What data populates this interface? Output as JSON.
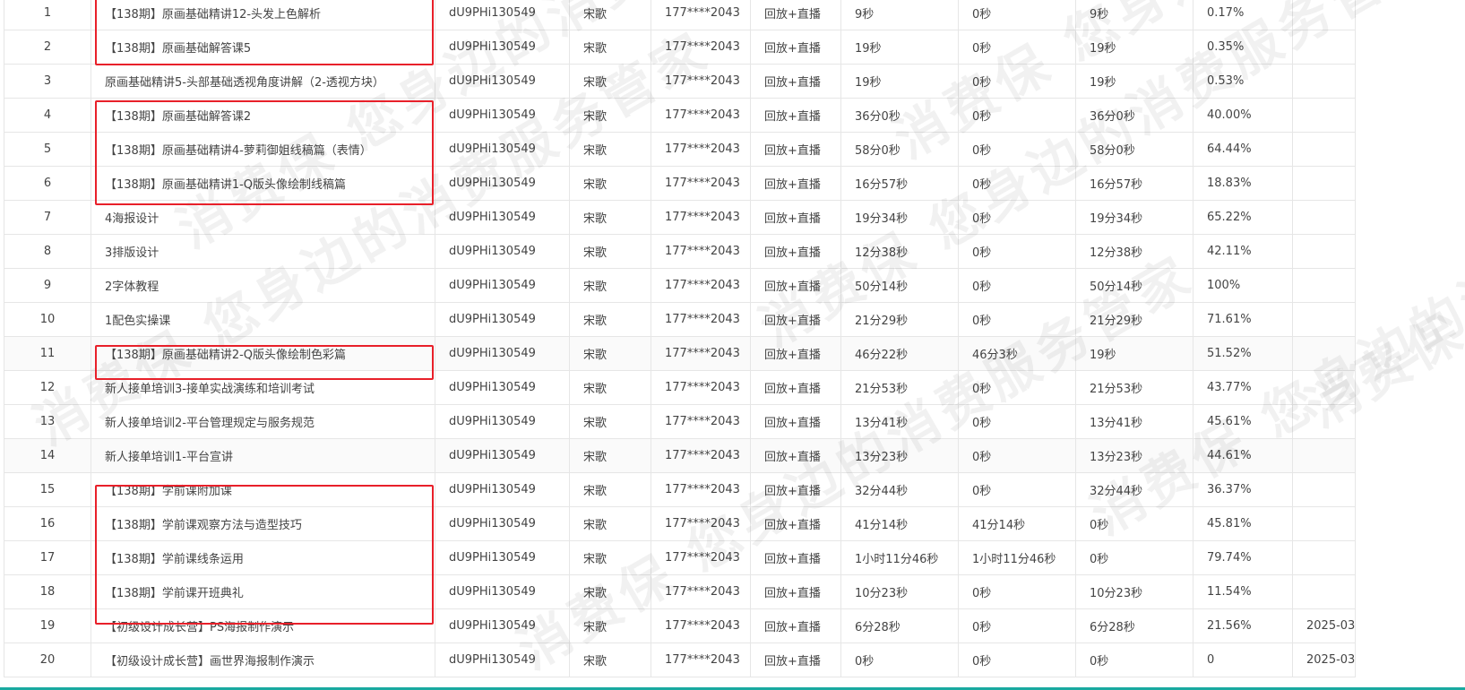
{
  "watermark": "消费保 您身边的消费服务管家",
  "colors": {
    "highlight_box": "#e8202a",
    "bottom_bar": "#19a9a0"
  },
  "rows": [
    {
      "idx": "1",
      "title": "【138期】原画基础精讲12-头发上色解析",
      "uid": "dU9PHi130549",
      "name": "宋歌",
      "phone": "177****2043",
      "mode": "回放+直播",
      "total": "9秒",
      "live": "0秒",
      "replay": "9秒",
      "rate": "0.17%",
      "date": ""
    },
    {
      "idx": "2",
      "title": "【138期】原画基础解答课5",
      "uid": "dU9PHi130549",
      "name": "宋歌",
      "phone": "177****2043",
      "mode": "回放+直播",
      "total": "19秒",
      "live": "0秒",
      "replay": "19秒",
      "rate": "0.35%",
      "date": ""
    },
    {
      "idx": "3",
      "title": "原画基础精讲5-头部基础透视角度讲解（2-透视方块）",
      "uid": "dU9PHi130549",
      "name": "宋歌",
      "phone": "177****2043",
      "mode": "回放+直播",
      "total": "19秒",
      "live": "0秒",
      "replay": "19秒",
      "rate": "0.53%",
      "date": ""
    },
    {
      "idx": "4",
      "title": "【138期】原画基础解答课2",
      "uid": "dU9PHi130549",
      "name": "宋歌",
      "phone": "177****2043",
      "mode": "回放+直播",
      "total": "36分0秒",
      "live": "0秒",
      "replay": "36分0秒",
      "rate": "40.00%",
      "date": ""
    },
    {
      "idx": "5",
      "title": "【138期】原画基础精讲4-萝莉御姐线稿篇（表情）",
      "uid": "dU9PHi130549",
      "name": "宋歌",
      "phone": "177****2043",
      "mode": "回放+直播",
      "total": "58分0秒",
      "live": "0秒",
      "replay": "58分0秒",
      "rate": "64.44%",
      "date": ""
    },
    {
      "idx": "6",
      "title": "【138期】原画基础精讲1-Q版头像绘制线稿篇",
      "uid": "dU9PHi130549",
      "name": "宋歌",
      "phone": "177****2043",
      "mode": "回放+直播",
      "total": "16分57秒",
      "live": "0秒",
      "replay": "16分57秒",
      "rate": "18.83%",
      "date": ""
    },
    {
      "idx": "7",
      "title": "4海报设计",
      "uid": "dU9PHi130549",
      "name": "宋歌",
      "phone": "177****2043",
      "mode": "回放+直播",
      "total": "19分34秒",
      "live": "0秒",
      "replay": "19分34秒",
      "rate": "65.22%",
      "date": ""
    },
    {
      "idx": "8",
      "title": "3排版设计",
      "uid": "dU9PHi130549",
      "name": "宋歌",
      "phone": "177****2043",
      "mode": "回放+直播",
      "total": "12分38秒",
      "live": "0秒",
      "replay": "12分38秒",
      "rate": "42.11%",
      "date": ""
    },
    {
      "idx": "9",
      "title": "2字体教程",
      "uid": "dU9PHi130549",
      "name": "宋歌",
      "phone": "177****2043",
      "mode": "回放+直播",
      "total": "50分14秒",
      "live": "0秒",
      "replay": "50分14秒",
      "rate": "100%",
      "date": ""
    },
    {
      "idx": "10",
      "title": "1配色实操课",
      "uid": "dU9PHi130549",
      "name": "宋歌",
      "phone": "177****2043",
      "mode": "回放+直播",
      "total": "21分29秒",
      "live": "0秒",
      "replay": "21分29秒",
      "rate": "71.61%",
      "date": ""
    },
    {
      "idx": "11",
      "title": "【138期】原画基础精讲2-Q版头像绘制色彩篇",
      "uid": "dU9PHi130549",
      "name": "宋歌",
      "phone": "177****2043",
      "mode": "回放+直播",
      "total": "46分22秒",
      "live": "46分3秒",
      "replay": "19秒",
      "rate": "51.52%",
      "date": ""
    },
    {
      "idx": "12",
      "title": "新人接单培训3-接单实战演练和培训考试",
      "uid": "dU9PHi130549",
      "name": "宋歌",
      "phone": "177****2043",
      "mode": "回放+直播",
      "total": "21分53秒",
      "live": "0秒",
      "replay": "21分53秒",
      "rate": "43.77%",
      "date": ""
    },
    {
      "idx": "13",
      "title": "新人接单培训2-平台管理规定与服务规范",
      "uid": "dU9PHi130549",
      "name": "宋歌",
      "phone": "177****2043",
      "mode": "回放+直播",
      "total": "13分41秒",
      "live": "0秒",
      "replay": "13分41秒",
      "rate": "45.61%",
      "date": ""
    },
    {
      "idx": "14",
      "title": "新人接单培训1-平台宣讲",
      "uid": "dU9PHi130549",
      "name": "宋歌",
      "phone": "177****2043",
      "mode": "回放+直播",
      "total": "13分23秒",
      "live": "0秒",
      "replay": "13分23秒",
      "rate": "44.61%",
      "date": ""
    },
    {
      "idx": "15",
      "title": "【138期】学前课附加课",
      "uid": "dU9PHi130549",
      "name": "宋歌",
      "phone": "177****2043",
      "mode": "回放+直播",
      "total": "32分44秒",
      "live": "0秒",
      "replay": "32分44秒",
      "rate": "36.37%",
      "date": ""
    },
    {
      "idx": "16",
      "title": "【138期】学前课观察方法与造型技巧",
      "uid": "dU9PHi130549",
      "name": "宋歌",
      "phone": "177****2043",
      "mode": "回放+直播",
      "total": "41分14秒",
      "live": "41分14秒",
      "replay": "0秒",
      "rate": "45.81%",
      "date": ""
    },
    {
      "idx": "17",
      "title": "【138期】学前课线条运用",
      "uid": "dU9PHi130549",
      "name": "宋歌",
      "phone": "177****2043",
      "mode": "回放+直播",
      "total": "1小时11分46秒",
      "live": "1小时11分46秒",
      "replay": "0秒",
      "rate": "79.74%",
      "date": ""
    },
    {
      "idx": "18",
      "title": "【138期】学前课开班典礼",
      "uid": "dU9PHi130549",
      "name": "宋歌",
      "phone": "177****2043",
      "mode": "回放+直播",
      "total": "10分23秒",
      "live": "0秒",
      "replay": "10分23秒",
      "rate": "11.54%",
      "date": ""
    },
    {
      "idx": "19",
      "title": "【初级设计成长营】PS海报制作演示",
      "uid": "dU9PHi130549",
      "name": "宋歌",
      "phone": "177****2043",
      "mode": "回放+直播",
      "total": "6分28秒",
      "live": "0秒",
      "replay": "6分28秒",
      "rate": "21.56%",
      "date": "2025-03"
    },
    {
      "idx": "20",
      "title": "【初级设计成长营】画世界海报制作演示",
      "uid": "dU9PHi130549",
      "name": "宋歌",
      "phone": "177****2043",
      "mode": "回放+直播",
      "total": "0秒",
      "live": "0秒",
      "replay": "0秒",
      "rate": "0",
      "date": "2025-03"
    }
  ]
}
